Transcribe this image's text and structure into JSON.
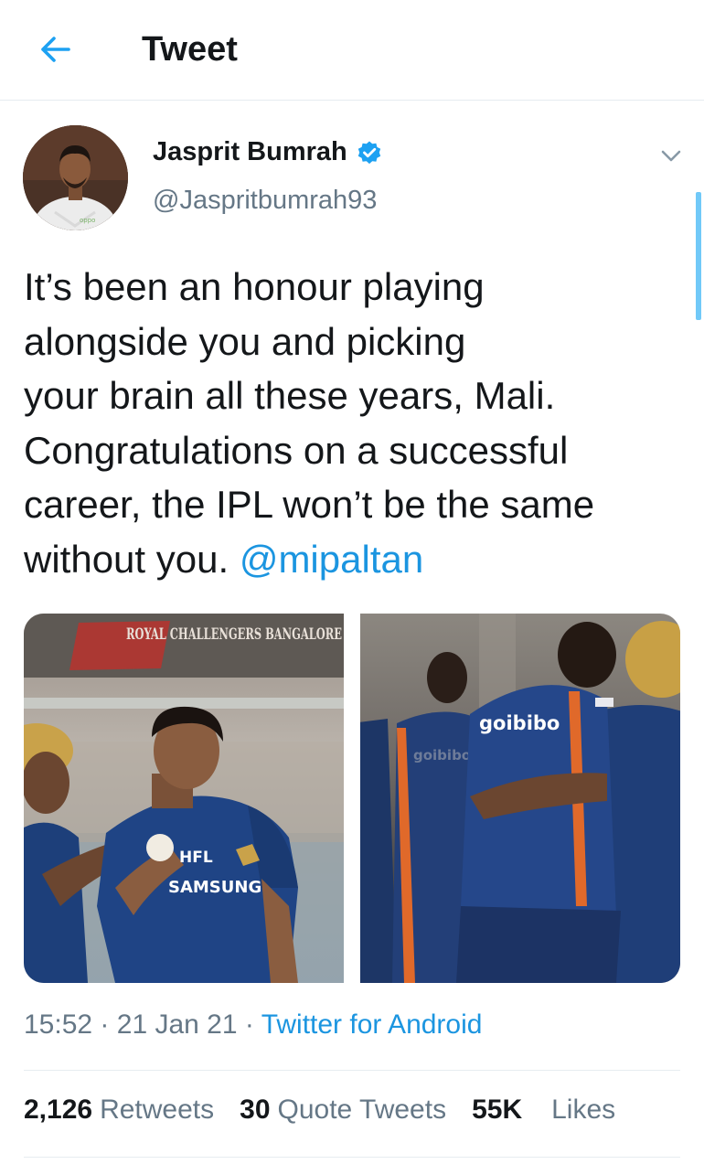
{
  "header": {
    "title": "Tweet",
    "back_icon": "arrow-left-icon",
    "accent": "#1da1f2"
  },
  "tweet": {
    "author": {
      "name": "Jasprit Bumrah",
      "handle": "@Jaspritbumrah93",
      "verified_icon": "verified-badge-icon"
    },
    "text_lines": [
      "It’s been an honour playing",
      "alongside you and picking",
      "your brain all these years, Mali.",
      "Congratulations on a successful",
      "career, the IPL won’t be the same",
      "without you. "
    ],
    "mention": "@mipaltan",
    "photos": [
      {
        "sign_text": "ROYAL CHALLENGERS BANGALORE",
        "jersey_text_1": "HFL",
        "jersey_text_2": "SAMSUNG"
      },
      {
        "jersey_text_1": "goibibo",
        "jersey_text_2": "goibibo"
      }
    ],
    "time": "15:52",
    "date": "21 Jan 21",
    "separator": "·",
    "source": "Twitter for Android"
  },
  "stats": {
    "retweets_count": "2,126",
    "retweets_label": "Retweets",
    "quotes_count": "30",
    "quotes_label": "Quote Tweets",
    "likes_count": "55K",
    "likes_label": "Likes"
  },
  "colors": {
    "text_primary": "#14171a",
    "text_secondary": "#657786",
    "link": "#1b95e0",
    "divider": "#e6ecf0"
  }
}
